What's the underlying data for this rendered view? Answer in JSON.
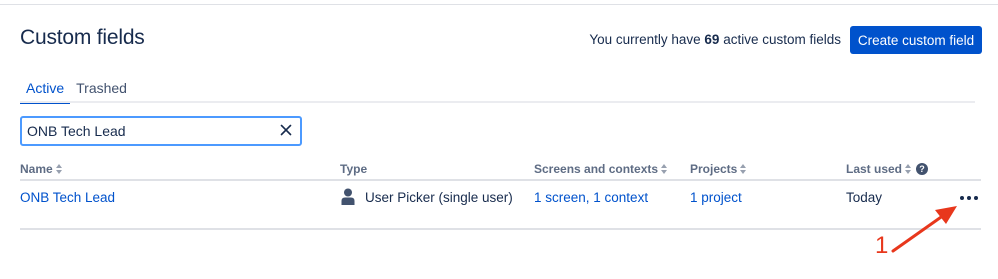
{
  "header": {
    "title": "Custom fields",
    "summary_prefix": "You currently have",
    "summary_count": "69",
    "summary_suffix": "active custom fields",
    "create_button_label": "Create custom field"
  },
  "tabs": [
    {
      "label": "Active",
      "active": true
    },
    {
      "label": "Trashed",
      "active": false
    }
  ],
  "search": {
    "value": "ONB Tech Lead"
  },
  "table": {
    "columns": [
      {
        "label": "Name",
        "sortable": true
      },
      {
        "label": "Type",
        "sortable": false
      },
      {
        "label": "Screens and contexts",
        "sortable": true
      },
      {
        "label": "Projects",
        "sortable": true
      },
      {
        "label": "Last used",
        "sortable": true,
        "help": true
      }
    ],
    "rows": [
      {
        "name": "ONB Tech Lead",
        "type": "User Picker (single user)",
        "type_icon": "user-icon",
        "screens_contexts": "1 screen, 1 context",
        "projects": "1 project",
        "last_used": "Today",
        "actions_icon": "more-icon"
      }
    ]
  },
  "annotation": {
    "label": "1",
    "color": "#e8371c"
  },
  "colors": {
    "primary": "#0052cc",
    "text": "#172b4d",
    "muted": "#5e6c84",
    "focus_border": "#4c9aff"
  }
}
